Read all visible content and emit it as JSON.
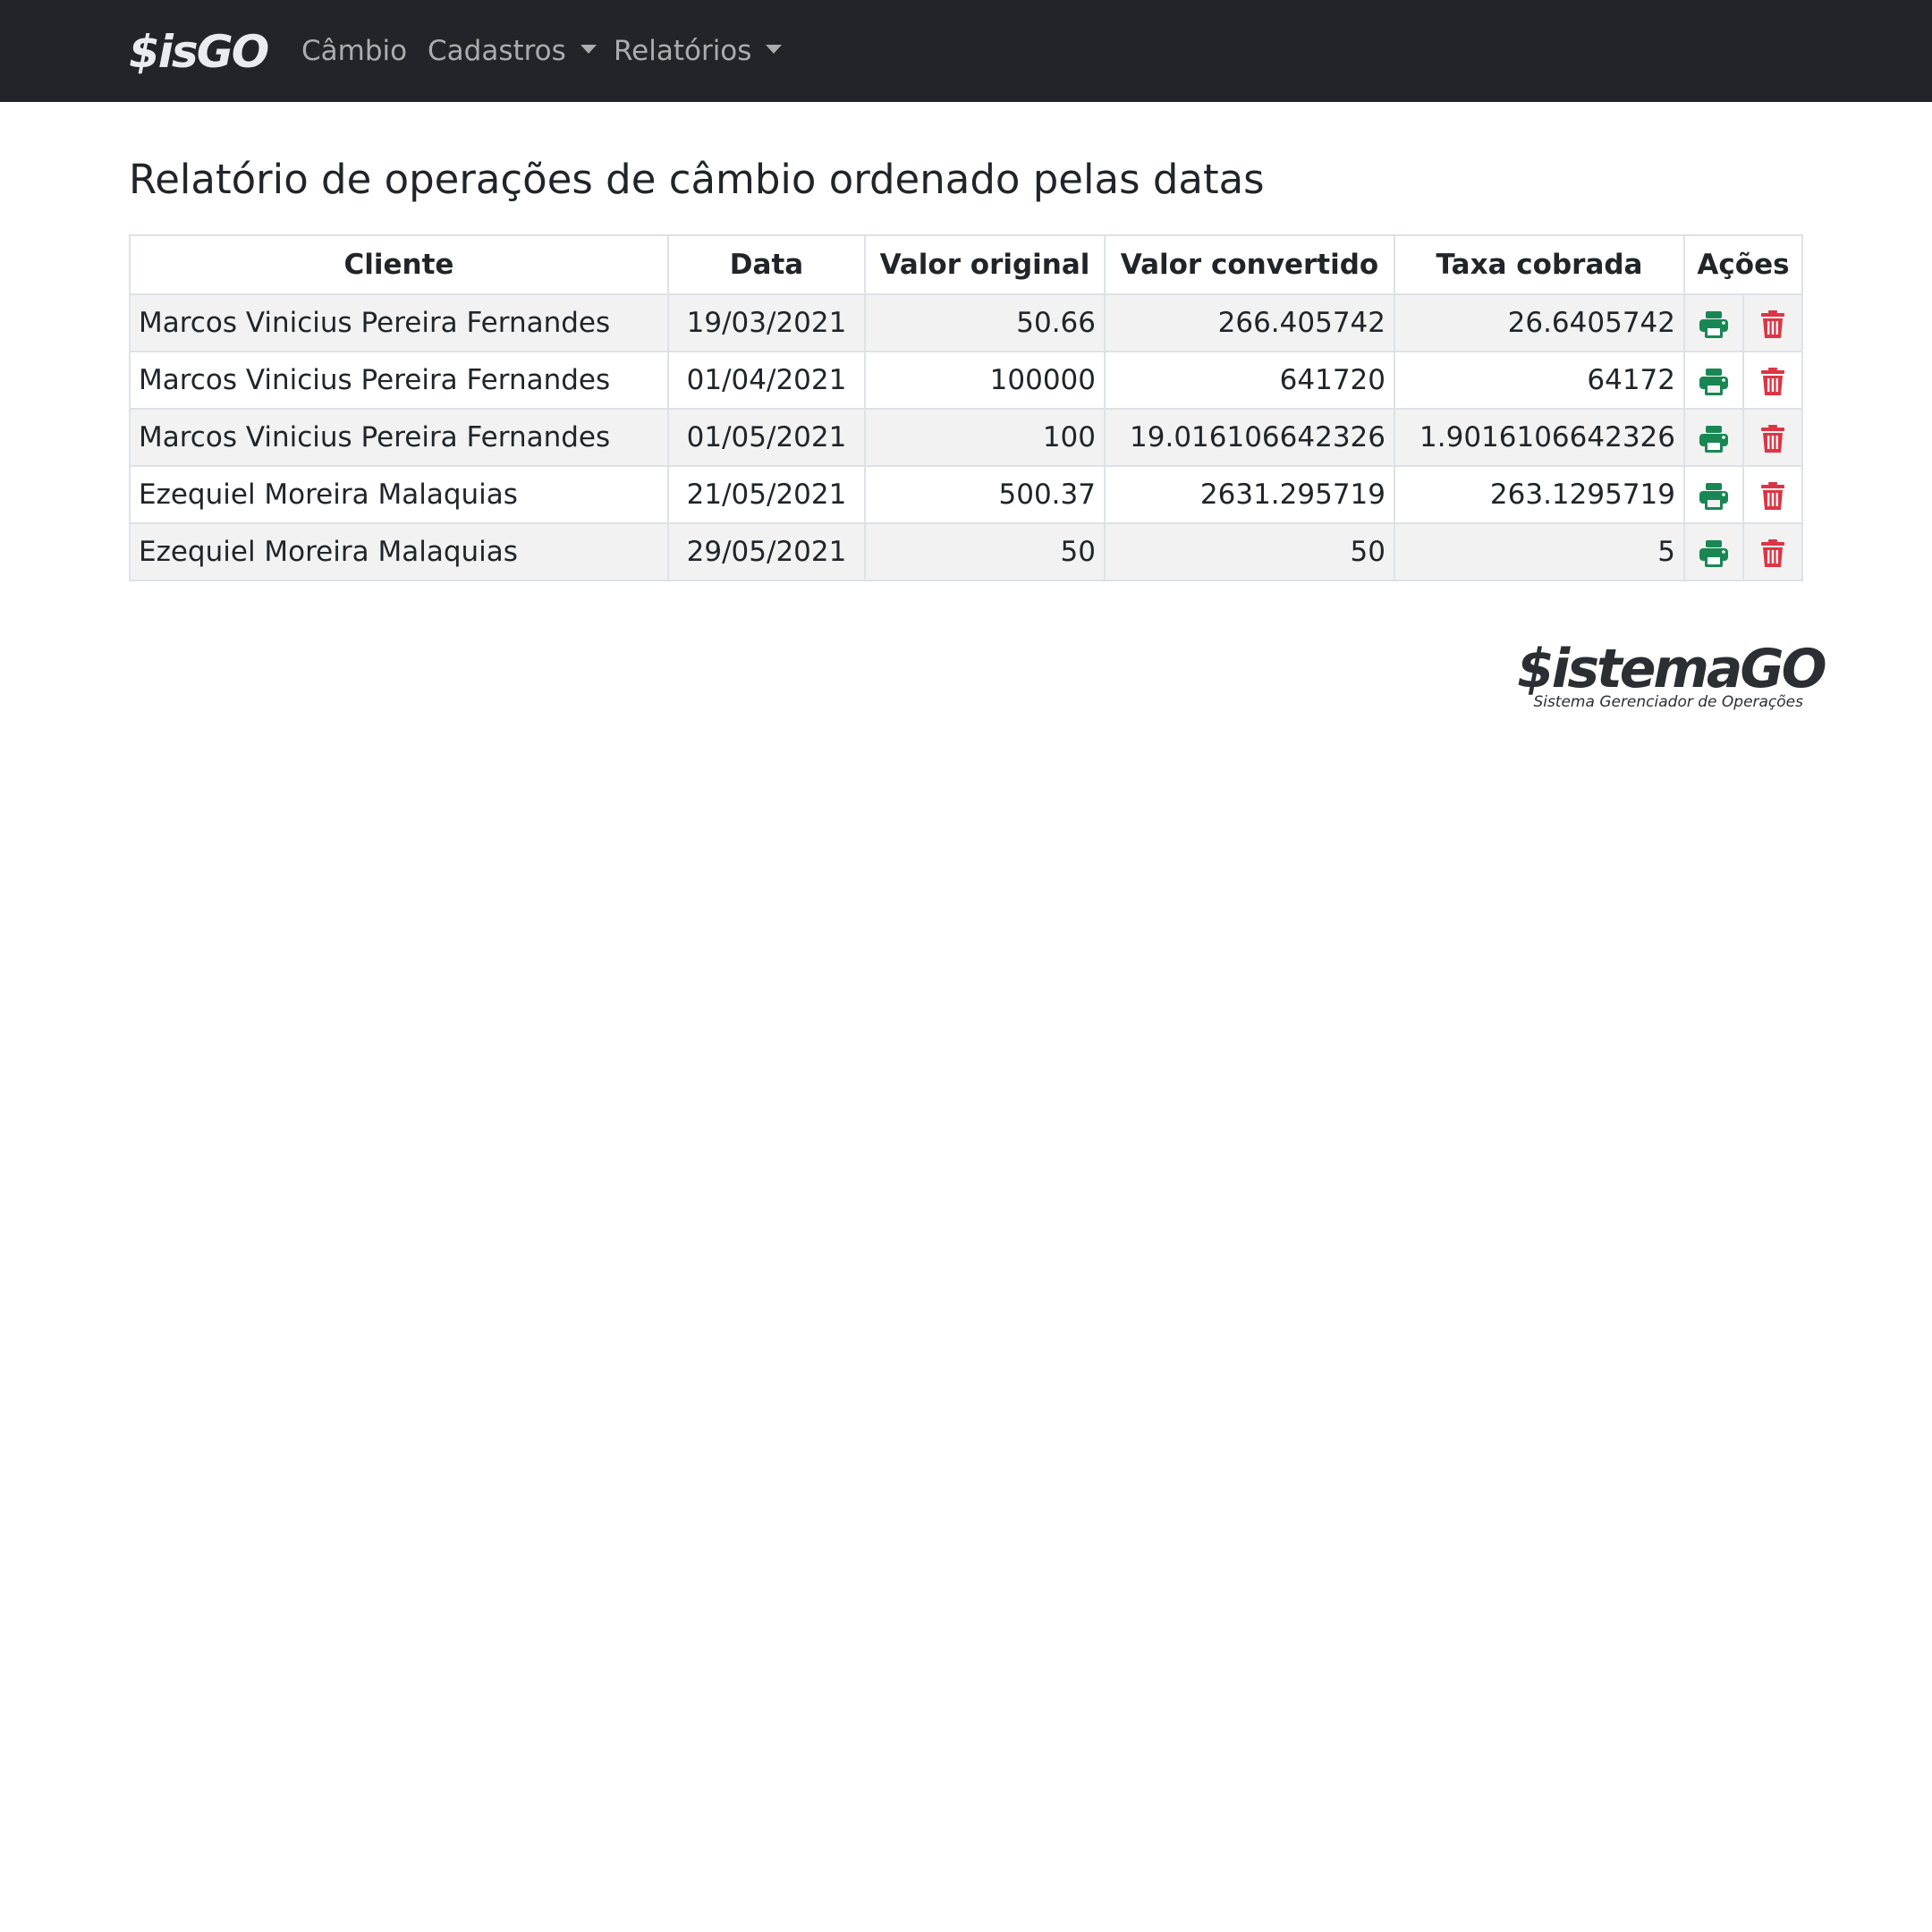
{
  "navbar": {
    "brand": "$isGO",
    "items": [
      {
        "label": "Câmbio"
      },
      {
        "label": "Cadastros"
      },
      {
        "label": "Relatórios"
      }
    ]
  },
  "page": {
    "title": "Relatório de operações de câmbio ordenado pelas datas"
  },
  "table": {
    "headers": {
      "client": "Cliente",
      "date": "Data",
      "original": "Valor original",
      "converted": "Valor convertido",
      "fee": "Taxa cobrada",
      "actions": "Ações"
    },
    "rows": [
      {
        "client": "Marcos Vinicius Pereira Fernandes",
        "date": "19/03/2021",
        "original": "50.66",
        "converted": "266.405742",
        "fee": "26.6405742"
      },
      {
        "client": "Marcos Vinicius Pereira Fernandes",
        "date": "01/04/2021",
        "original": "100000",
        "converted": "641720",
        "fee": "64172"
      },
      {
        "client": "Marcos Vinicius Pereira Fernandes",
        "date": "01/05/2021",
        "original": "100",
        "converted": "19.016106642326",
        "fee": "1.9016106642326"
      },
      {
        "client": "Ezequiel Moreira Malaquias",
        "date": "21/05/2021",
        "original": "500.37",
        "converted": "2631.295719",
        "fee": "263.1295719"
      },
      {
        "client": "Ezequiel Moreira Malaquias",
        "date": "29/05/2021",
        "original": "50",
        "converted": "50",
        "fee": "5"
      }
    ],
    "row_actions": {
      "print_icon": "print-icon",
      "delete_icon": "trash-icon"
    }
  },
  "footer_logo": {
    "main": "$istemaGO",
    "sub": "Sistema Gerenciador de Operações"
  },
  "colors": {
    "navbar": "#212529",
    "print": "#198754",
    "delete": "#dc3545",
    "stripe": "#f2f2f2"
  }
}
